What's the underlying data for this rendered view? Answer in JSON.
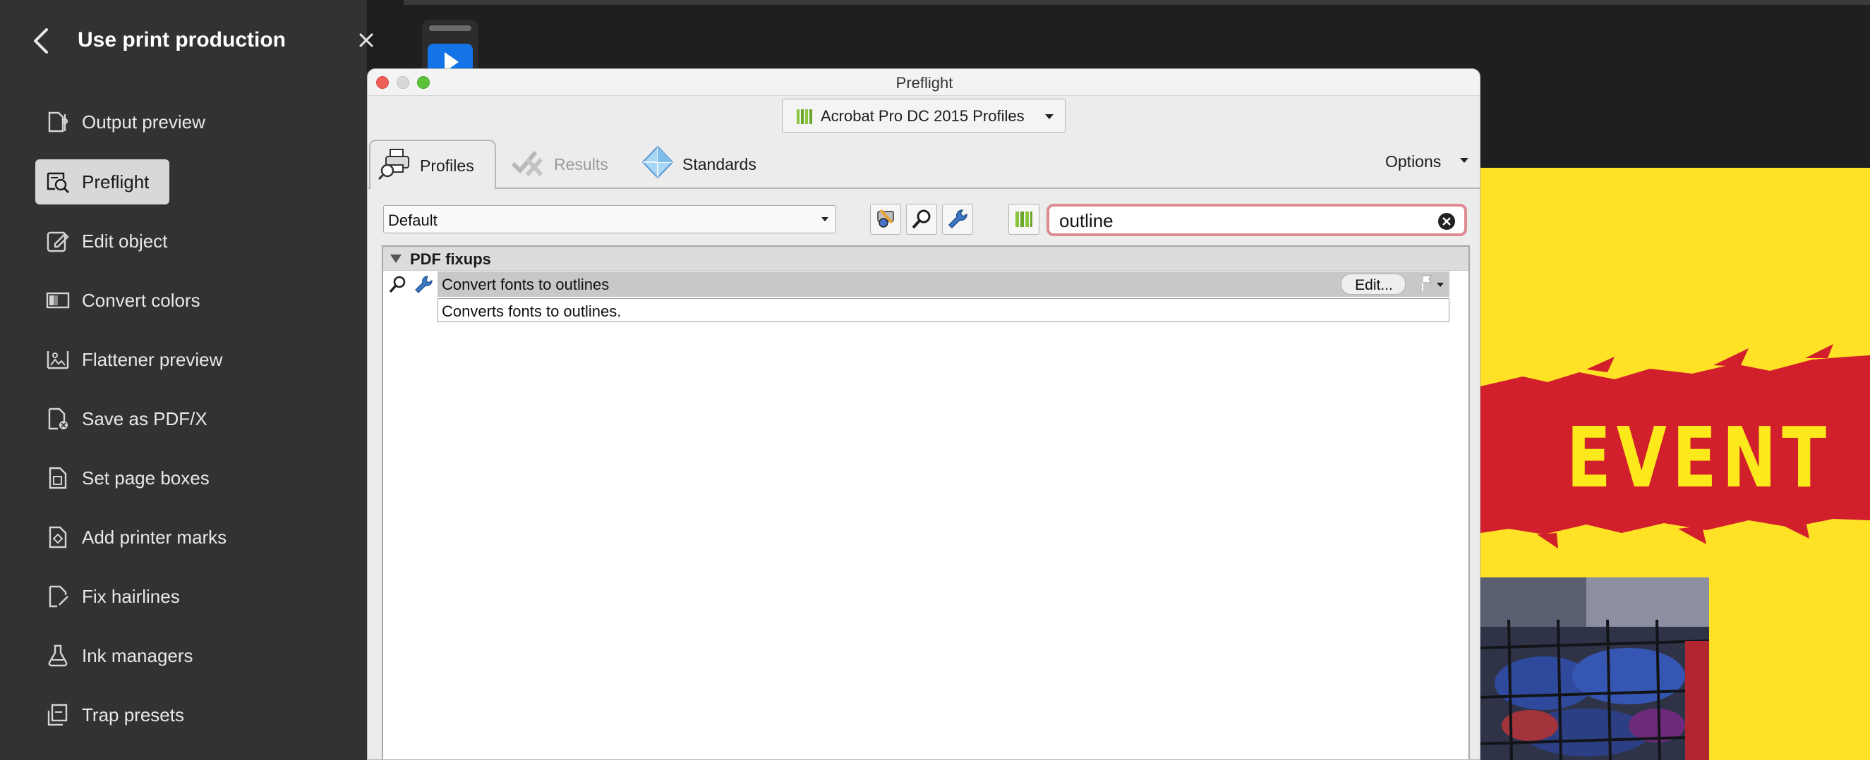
{
  "left_panel": {
    "title": "Use print production",
    "items": [
      {
        "label": "Output preview",
        "active": false
      },
      {
        "label": "Preflight",
        "active": true
      },
      {
        "label": "Edit object",
        "active": false
      },
      {
        "label": "Convert colors",
        "active": false
      },
      {
        "label": "Flattener preview",
        "active": false
      },
      {
        "label": "Save as PDF/X",
        "active": false
      },
      {
        "label": "Set page boxes",
        "active": false
      },
      {
        "label": "Add printer marks",
        "active": false
      },
      {
        "label": "Fix hairlines",
        "active": false
      },
      {
        "label": "Ink managers",
        "active": false
      },
      {
        "label": "Trap presets",
        "active": false
      }
    ]
  },
  "preflight": {
    "window_title": "Preflight",
    "profile_library": "Acrobat Pro DC 2015 Profiles",
    "tabs": [
      {
        "label": "Profiles",
        "active": true,
        "enabled": true
      },
      {
        "label": "Results",
        "active": false,
        "enabled": false
      },
      {
        "label": "Standards",
        "active": false,
        "enabled": true
      }
    ],
    "options_label": "Options",
    "category_select": "Default",
    "search": {
      "value": "outline"
    },
    "group": {
      "label": "PDF fixups",
      "expanded": true
    },
    "fixup": {
      "label": "Convert fonts to outlines",
      "edit_label": "Edit...",
      "description": "Converts fonts to outlines."
    }
  },
  "document_preview": {
    "headline": "EVENT"
  },
  "colors": {
    "panel_bg": "#323232",
    "active_item_bg": "#d8d8d8",
    "search_focus_ring": "#de8a92",
    "selected_row": "#c8c8c8",
    "doc_yellow": "#ffe226",
    "doc_red": "#d21f2c",
    "accent_blue": "#1473e6"
  },
  "icons": {
    "back": "chevron-left-icon",
    "close": "close-icon",
    "profiles_tab": "printer-magnifier-icon",
    "results_tab": "check-cross-icon",
    "standards_tab": "diamond-icon",
    "library": "bars-library-icon",
    "clear_search": "clear-circle-icon"
  }
}
